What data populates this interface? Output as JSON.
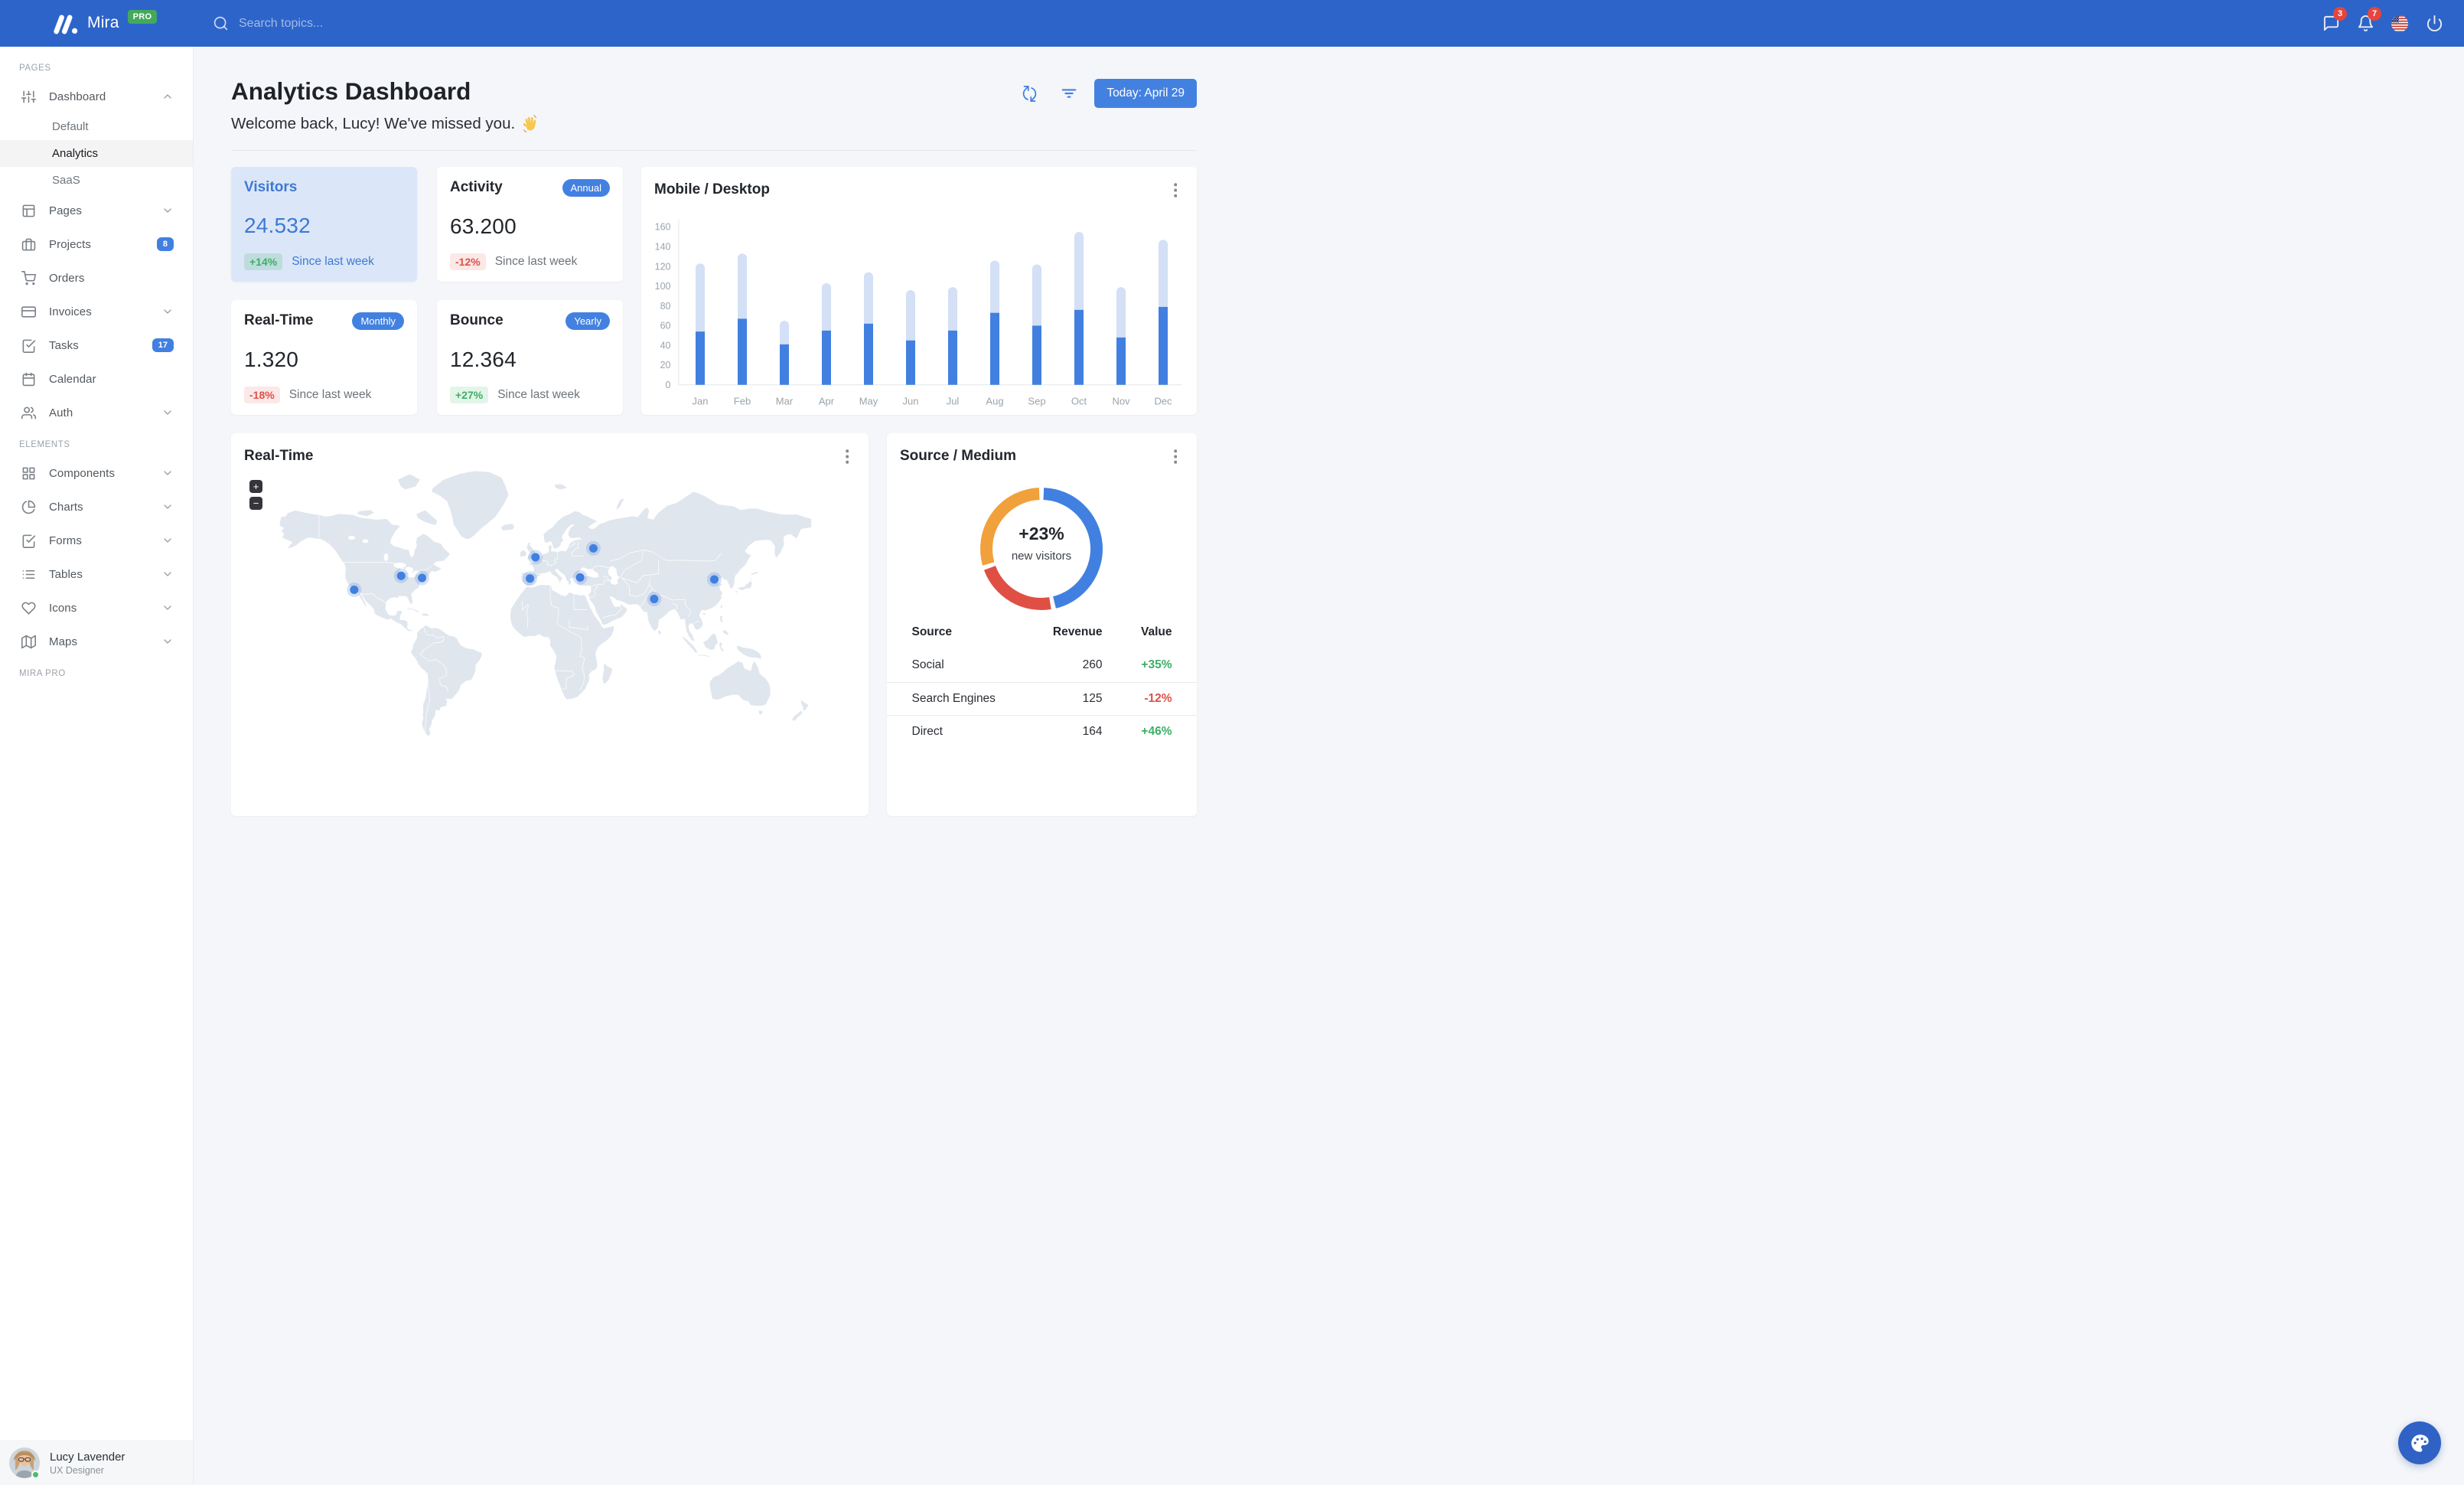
{
  "theme": {
    "primary": "#4180e0",
    "navbar_bg": "#2d64c9",
    "success": "#4bbf73",
    "danger": "#e04f44",
    "warning": "#f0a13b",
    "page_bg": "#f4f6fa",
    "bar_light": "#d3e0f5"
  },
  "navbar": {
    "brand": "Mira",
    "brand_badge": "PRO",
    "search_placeholder": "Search topics...",
    "messages_count": "3",
    "notifications_count": "7",
    "icons": [
      "mira-logo",
      "search",
      "message-square",
      "bell",
      "us-flag",
      "power"
    ]
  },
  "sidebar": {
    "sections": [
      {
        "label": "PAGES",
        "items": [
          {
            "label": "Dashboard",
            "icon": "sliders",
            "chevron": "up",
            "children": [
              {
                "label": "Default",
                "active": false
              },
              {
                "label": "Analytics",
                "active": true
              },
              {
                "label": "SaaS",
                "active": false
              }
            ]
          },
          {
            "label": "Pages",
            "icon": "layout",
            "chevron": "down"
          },
          {
            "label": "Projects",
            "icon": "briefcase",
            "badge": "8"
          },
          {
            "label": "Orders",
            "icon": "cart"
          },
          {
            "label": "Invoices",
            "icon": "credit-card",
            "chevron": "down"
          },
          {
            "label": "Tasks",
            "icon": "check-square",
            "badge": "17"
          },
          {
            "label": "Calendar",
            "icon": "calendar"
          },
          {
            "label": "Auth",
            "icon": "users",
            "chevron": "down"
          }
        ]
      },
      {
        "label": "ELEMENTS",
        "items": [
          {
            "label": "Components",
            "icon": "grid",
            "chevron": "down"
          },
          {
            "label": "Charts",
            "icon": "pie-chart",
            "chevron": "down"
          },
          {
            "label": "Forms",
            "icon": "check-square",
            "chevron": "down"
          },
          {
            "label": "Tables",
            "icon": "list",
            "chevron": "down"
          },
          {
            "label": "Icons",
            "icon": "heart",
            "chevron": "down"
          },
          {
            "label": "Maps",
            "icon": "map",
            "chevron": "down"
          }
        ]
      },
      {
        "label": "MIRA PRO",
        "items": []
      }
    ],
    "user": {
      "name": "Lucy Lavender",
      "role": "UX Designer"
    }
  },
  "header": {
    "title": "Analytics Dashboard",
    "subtitle": "Welcome back, Lucy! We've missed you.",
    "wave_emoji": "wave-hand",
    "icons": [
      "refresh",
      "filter"
    ],
    "button": "Today: April 29"
  },
  "stats": [
    {
      "title": "Visitors",
      "pill": "",
      "value": "24.532",
      "badge": "+14%",
      "badge_type": "success",
      "caption": "Since last week",
      "highlight": true
    },
    {
      "title": "Activity",
      "pill": "Annual",
      "value": "63.200",
      "badge": "-12%",
      "badge_type": "danger",
      "caption": "Since last week",
      "highlight": false
    },
    {
      "title": "Real-Time",
      "pill": "Monthly",
      "value": "1.320",
      "badge": "-18%",
      "badge_type": "danger",
      "caption": "Since last week",
      "highlight": false
    },
    {
      "title": "Bounce",
      "pill": "Yearly",
      "value": "12.364",
      "badge": "+27%",
      "badge_type": "success",
      "caption": "Since last week",
      "highlight": false
    }
  ],
  "chart_data": [
    {
      "type": "bar",
      "title": "Mobile / Desktop",
      "stacked": true,
      "categories": [
        "Jan",
        "Feb",
        "Mar",
        "Apr",
        "May",
        "Jun",
        "Jul",
        "Aug",
        "Sep",
        "Oct",
        "Nov",
        "Dec"
      ],
      "series": [
        {
          "name": "Mobile",
          "color": "#4180e0",
          "values": [
            54,
            67,
            41,
            55,
            62,
            45,
            55,
            73,
            60,
            76,
            48,
            79
          ]
        },
        {
          "name": "Desktop",
          "color": "#d3e0f5",
          "values": [
            69,
            66,
            24,
            48,
            52,
            51,
            44,
            53,
            62,
            79,
            51,
            68
          ]
        }
      ],
      "ylabel": "",
      "xlabel": "",
      "ylim": [
        0,
        160
      ],
      "yticks": [
        0,
        20,
        40,
        60,
        80,
        100,
        120,
        140,
        160
      ],
      "grid": false,
      "legend": "none"
    },
    {
      "type": "pie",
      "title": "Source / Medium",
      "donut": true,
      "center_value": "+23%",
      "center_label": "new visitors",
      "segments": [
        {
          "label": "Social",
          "value": 260,
          "color": "#4180e0"
        },
        {
          "label": "Search Engines",
          "value": 125,
          "color": "#e04f44"
        },
        {
          "label": "Direct",
          "value": 164,
          "color": "#f0a13b"
        }
      ]
    }
  ],
  "realtime_map": {
    "title": "Real-Time",
    "zoom_in": "+",
    "zoom_out": "−",
    "markers": [
      {
        "city": "Los Angeles",
        "x": 247.7,
        "y": 315.0
      },
      {
        "city": "Chicago",
        "x": 370.5,
        "y": 278.5
      },
      {
        "city": "New York",
        "x": 425.2,
        "y": 284.1
      },
      {
        "city": "London",
        "x": 721.5,
        "y": 229.9
      },
      {
        "city": "Madrid",
        "x": 707.2,
        "y": 285.5
      },
      {
        "city": "Moscow",
        "x": 872.9,
        "y": 206.7
      },
      {
        "city": "Istanbul",
        "x": 838.2,
        "y": 282.8
      },
      {
        "city": "New Delhi",
        "x": 1031.7,
        "y": 339.1
      },
      {
        "city": "Beijing",
        "x": 1188.9,
        "y": 288.0
      }
    ]
  },
  "source_table": {
    "headers": [
      "Source",
      "Revenue",
      "Value"
    ],
    "rows": [
      {
        "source": "Social",
        "revenue": "260",
        "value": "+35%",
        "trend": "up"
      },
      {
        "source": "Search Engines",
        "revenue": "125",
        "value": "-12%",
        "trend": "down"
      },
      {
        "source": "Direct",
        "revenue": "164",
        "value": "+46%",
        "trend": "up"
      }
    ]
  }
}
